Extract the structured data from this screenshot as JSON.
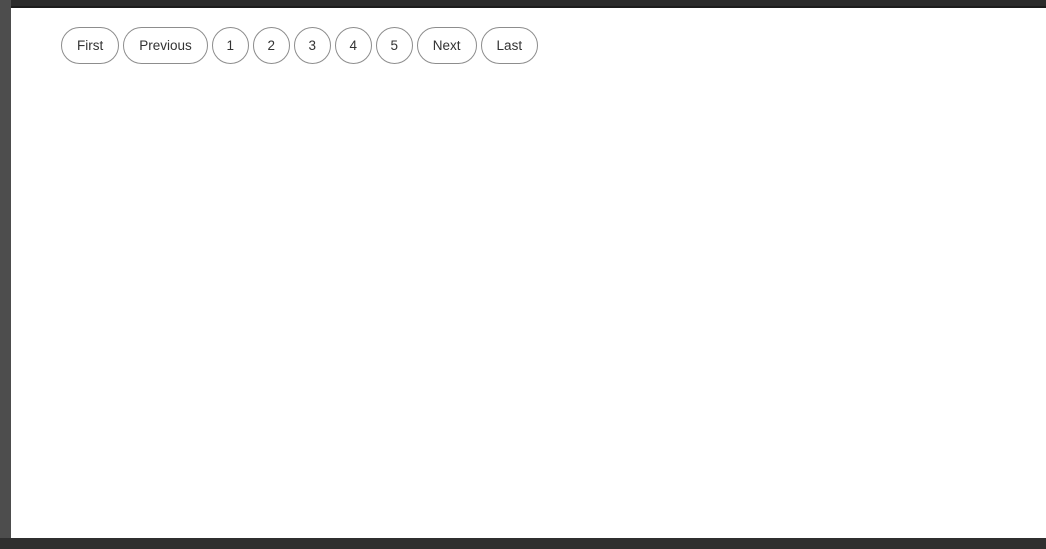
{
  "colors": {
    "top_bar": "#2b2b2b",
    "left_bar": "#4d4d4d",
    "bottom_bar": "#2f2f2f",
    "content_bg": "#ffffff",
    "button_border": "#8d8d8d",
    "button_text": "#333333"
  },
  "pagination": {
    "first_label": "First",
    "previous_label": "Previous",
    "pages": [
      "1",
      "2",
      "3",
      "4",
      "5"
    ],
    "next_label": "Next",
    "last_label": "Last"
  }
}
